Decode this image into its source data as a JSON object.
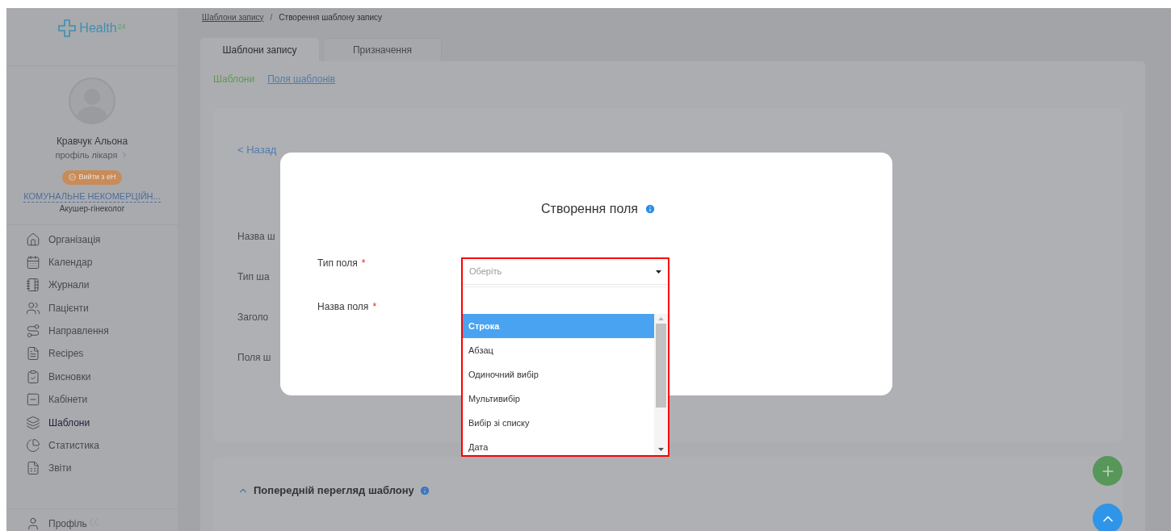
{
  "logo": {
    "text": "Health",
    "superscript": "24"
  },
  "profile": {
    "name": "Кравчук Альона",
    "link": "профіль лікаря",
    "badge": "Вийти з еН",
    "organization": "КОМУНАЛЬНЕ НЕКОМЕРЦІЙН...",
    "specialty": "Акушер-гінеколог"
  },
  "nav": [
    {
      "label": "Організація",
      "selected": false
    },
    {
      "label": "Календар",
      "selected": false
    },
    {
      "label": "Журнали",
      "selected": false
    },
    {
      "label": "Пацієнти",
      "selected": false
    },
    {
      "label": "Направлення",
      "selected": false
    },
    {
      "label": "Recipes",
      "selected": false
    },
    {
      "label": "Висновки",
      "selected": false
    },
    {
      "label": "Кабінети",
      "selected": false
    },
    {
      "label": "Шаблони",
      "selected": true
    },
    {
      "label": "Статистика",
      "selected": false
    },
    {
      "label": "Звіти",
      "selected": false
    }
  ],
  "bottom_nav": {
    "label": "Профіль"
  },
  "breadcrumb_separator": "/",
  "breadcrumb": [
    {
      "label": "Шаблони запису",
      "link": true
    },
    {
      "label": "Створення шаблону запису",
      "link": false
    }
  ],
  "tabs": [
    {
      "label": "Шаблони запису",
      "selected": true
    },
    {
      "label": "Призначення",
      "selected": false
    }
  ],
  "subtabs": [
    {
      "label": "Шаблони",
      "selected": true
    },
    {
      "label": "Поля шаблонів",
      "selected": false
    }
  ],
  "back_link": "< Назад",
  "form_labels": [
    "Назва ш",
    "Тип ша",
    "Заголо",
    "Поля ш"
  ],
  "preview": {
    "title": "Попередній перегляд шаблону",
    "expanded": true
  },
  "modal": {
    "title": "Створення поля",
    "required_mark": "*",
    "fields": [
      {
        "label": "Тип поля",
        "required": true
      },
      {
        "label": "Назва поля",
        "required": true
      }
    ],
    "dropdown": {
      "placeholder": "Оберіть",
      "options": [
        {
          "label": "Строка",
          "selected": true
        },
        {
          "label": "Абзац",
          "selected": false
        },
        {
          "label": "Одиночний вибір",
          "selected": false
        },
        {
          "label": "Мультивибір",
          "selected": false
        },
        {
          "label": "Вибір зі списку",
          "selected": false
        },
        {
          "label": "Дата",
          "selected": false
        }
      ]
    }
  }
}
